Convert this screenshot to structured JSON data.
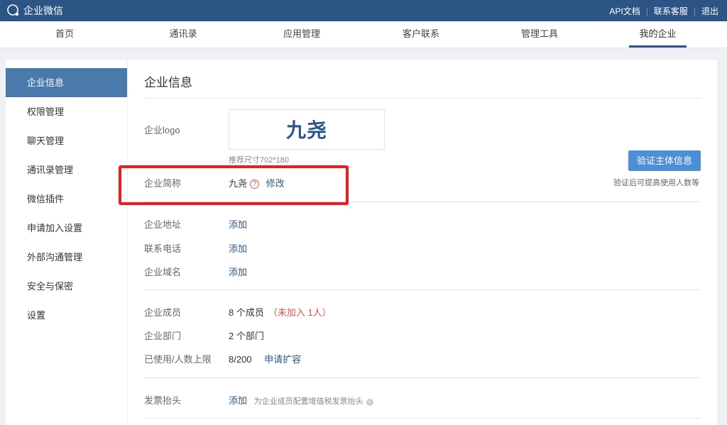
{
  "topbar": {
    "app_title": "企业微信",
    "links": {
      "api_docs": "API文档",
      "support": "联系客服",
      "logout": "退出"
    }
  },
  "nav": {
    "tabs": [
      "首页",
      "通讯录",
      "应用管理",
      "客户联系",
      "管理工具",
      "我的企业"
    ],
    "active": "我的企业"
  },
  "sidebar": {
    "items": [
      "企业信息",
      "权限管理",
      "聊天管理",
      "通讯录管理",
      "微信插件",
      "申请加入设置",
      "外部沟通管理",
      "安全与保密",
      "设置"
    ],
    "active": "企业信息"
  },
  "main": {
    "title": "企业信息",
    "logo": {
      "label": "企业logo",
      "image_text": "九尧",
      "size_hint": "推荐尺寸702*180"
    },
    "verify": {
      "button": "验证主体信息",
      "tip": "验证后可提高使用人数等"
    },
    "short_name": {
      "label": "企业简称",
      "value": "九尧",
      "edit": "修改"
    },
    "address": {
      "label": "企业地址",
      "action": "添加"
    },
    "phone": {
      "label": "联系电话",
      "action": "添加"
    },
    "domain": {
      "label": "企业域名",
      "action": "添加"
    },
    "members": {
      "label": "企业成员",
      "value": "8 个成员",
      "not_joined": "（未加入 1人）"
    },
    "departments": {
      "label": "企业部门",
      "value": "2 个部门"
    },
    "usage": {
      "label": "已使用/人数上限",
      "value": "8/200",
      "action": "申请扩容"
    },
    "invoice": {
      "label": "发票抬头",
      "action": "添加",
      "hint": "为企业成员配置增值税发票抬头"
    }
  },
  "colors": {
    "topbar": "#2c5586",
    "sidebar_active": "#4a79ab",
    "link": "#2c5586",
    "button": "#4d8ed8",
    "warning": "#e0504a",
    "highlight": "#f21a1a"
  }
}
